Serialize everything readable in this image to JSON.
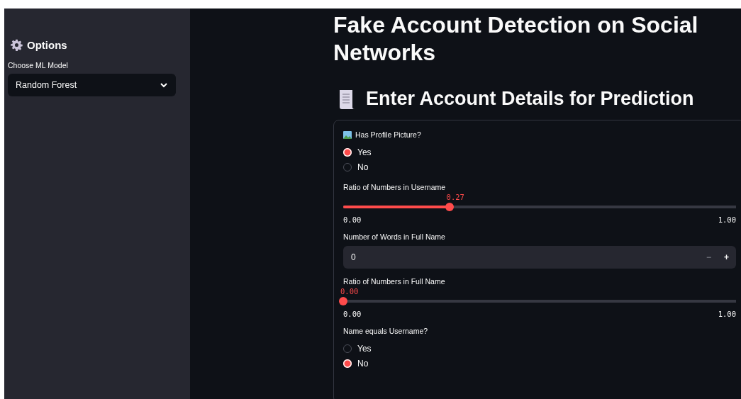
{
  "sidebar": {
    "title": "Options",
    "model_label": "Choose ML Model",
    "model_value": "Random Forest"
  },
  "title": "Fake Account Detection on Social Networks",
  "subheader": "Enter Account Details for Prediction",
  "fields": [
    {
      "kind": "radio",
      "label": "Has Profile Picture?",
      "icon": true,
      "options": [
        {
          "label": "Yes",
          "selected": true
        },
        {
          "label": "No",
          "selected": false
        }
      ]
    },
    {
      "kind": "slider",
      "label": "Ratio of Numbers in Username",
      "value": "0.27",
      "level": 0.27,
      "min": "0.00",
      "max": "1.00"
    },
    {
      "kind": "number",
      "label": "Number of Words in Full Name",
      "value": "0",
      "minus": "−",
      "plus": "+"
    },
    {
      "kind": "slider",
      "label": "Ratio of Numbers in Full Name",
      "value": "0.00",
      "level": 0,
      "min": "0.00",
      "max": "1.00"
    },
    {
      "kind": "radio",
      "label": "Name equals Username?",
      "icon": false,
      "options": [
        {
          "label": "Yes",
          "selected": false
        },
        {
          "label": "No",
          "selected": true
        }
      ]
    }
  ]
}
